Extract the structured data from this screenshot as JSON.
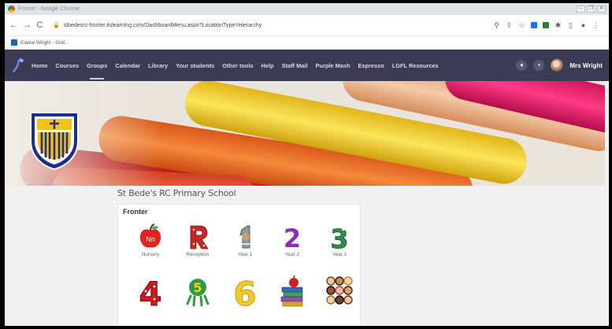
{
  "window": {
    "title": "Fronter - Google Chrome",
    "controls": [
      "–",
      "❐",
      "✕"
    ]
  },
  "browser": {
    "url": "stbedesrc-fronter.itslearning.com/DashboardMenu.aspx?LocationType=Hierarchy",
    "bookmark": "Elaine Wright - Outl..."
  },
  "nav": {
    "items": [
      "Home",
      "Courses",
      "Groups",
      "Calendar",
      "Library",
      "Your students",
      "Other tools",
      "Help",
      "Staff Mail",
      "Purple Mash",
      "Espresso",
      "LGFL Resources"
    ],
    "active_index": 2,
    "user_name": "Mrs Wright"
  },
  "school_name": "St Bede's RC Primary School",
  "card": {
    "title": "Fronter",
    "tiles": [
      {
        "label": "Nursery",
        "icon": "apple-nursery-icon"
      },
      {
        "label": "Reception",
        "icon": "letter-r-icon"
      },
      {
        "label": "Year 1",
        "icon": "number-1-icon"
      },
      {
        "label": "Year 2",
        "icon": "number-2-icon"
      },
      {
        "label": "Year 3",
        "icon": "number-3-icon"
      },
      {
        "label": "",
        "icon": "number-4-icon"
      },
      {
        "label": "",
        "icon": "number-5-icon"
      },
      {
        "label": "",
        "icon": "number-6-icon"
      },
      {
        "label": "",
        "icon": "books-apple-icon"
      },
      {
        "label": "",
        "icon": "faces-icon"
      }
    ]
  },
  "colors": {
    "nav_bg": "#3c3b55",
    "page_bg": "#f1f1f1",
    "crest_blue": "#1f2f86",
    "crest_gold": "#f2c21b"
  }
}
